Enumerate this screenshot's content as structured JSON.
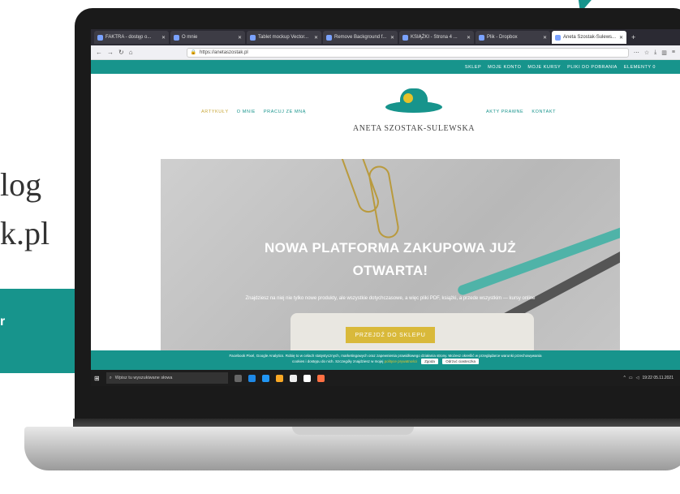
{
  "background": {
    "line1": "log",
    "line2": "k.pl",
    "teal_fragment": "r"
  },
  "browser": {
    "tabs": [
      {
        "label": "FAKTRA - dostęp o..."
      },
      {
        "label": "O mnie"
      },
      {
        "label": "Tablet mockup Vector..."
      },
      {
        "label": "Remove Background f..."
      },
      {
        "label": "KSIĄŻKI - Strona 4 ..."
      },
      {
        "label": "Plik - Dropbox"
      },
      {
        "label": "Aneta Szostak-Sulews..."
      }
    ],
    "url": "https://anetaszostak.pl"
  },
  "site": {
    "topbar": [
      "SKLEP",
      "MOJE KONTO",
      "MOJE KURSY",
      "PLIKI DO POBRANIA",
      "ELEMENTY 0"
    ],
    "nav_left": [
      "ARTYKUŁY",
      "O MNIE",
      "PRACUJ ZE MNĄ"
    ],
    "nav_right": [
      "AKTY PRAWNE",
      "KONTAKT"
    ],
    "logo_text": "ANETA SZOSTAK-SULEWSKA",
    "hero": {
      "title_line1": "NOWA PLATFORMA ZAKUPOWA JUŻ",
      "title_line2": "OTWARTA!",
      "subtitle": "Znajdziesz na niej nie tylko nowe produkty, ale wszystkie dotychczasowe, a więc pliki PDF, książki, a przede wszystkim — kursy online",
      "cta": "PRZEJDŹ DO SKLEPU"
    },
    "cookie": {
      "text": "Facebook Pixel, Google Analytics. Robię to w celach statystycznych, marketingowych oraz zapewnienia prawidłowego działania strony. Możesz określić w przeglądarce warunki przechowywania",
      "text2": "cookies i dostępu do nich. Szczegóły znajdziesz w mojej",
      "link": "polityce prywatności",
      "accept": "Zgoda",
      "reject": "Odrzuć ciasteczka"
    }
  },
  "taskbar": {
    "search_placeholder": "Wpisz tu wyszukiwane słowa",
    "time": "19:22",
    "date": "05.11.2021"
  }
}
